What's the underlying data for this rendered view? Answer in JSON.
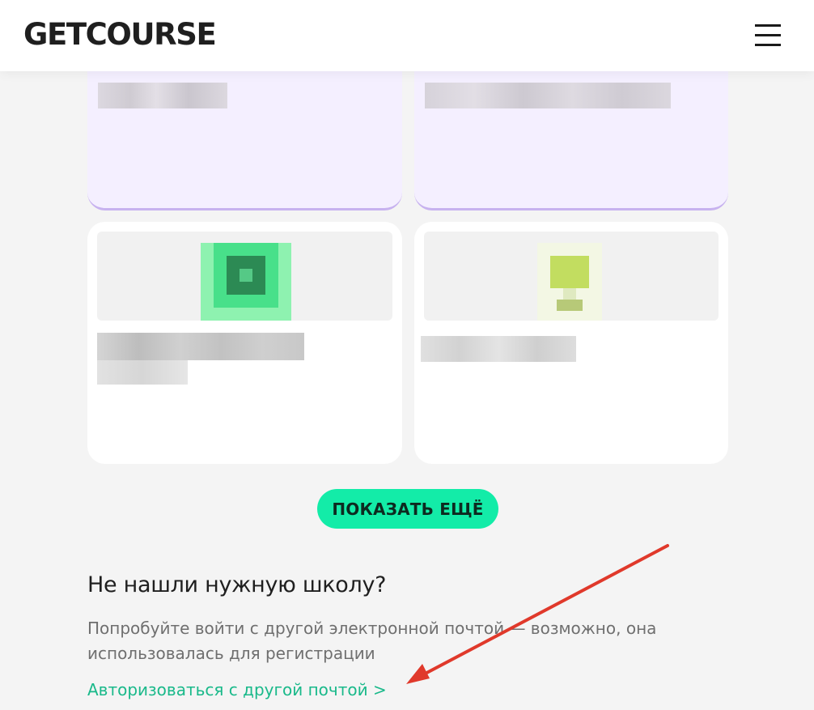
{
  "header": {
    "logo": "GETCOURSE",
    "menu_icon": "hamburger-menu-icon"
  },
  "main": {
    "show_more_label": "ПОКАЗАТЬ ЕЩЁ"
  },
  "not_found": {
    "title": "Не нашли нужную школу?",
    "description": "Попробуйте войти с другой электронной почтой — возможно, она использовалась для регистрации",
    "link_label": "Авторизоваться с другой почтой >"
  },
  "annotation": {
    "arrow_icon": "red-arrow-icon",
    "arrow_color": "#e0392b"
  },
  "colors": {
    "accent": "#13eca8",
    "link": "#19b98a",
    "card_highlight": "#f4efff",
    "card_highlight_border": "#c7b2ef"
  }
}
